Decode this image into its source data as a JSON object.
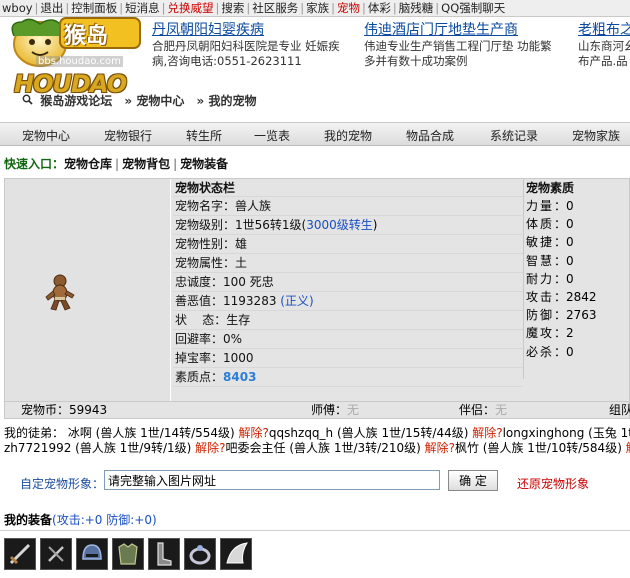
{
  "topbar": {
    "items": [
      {
        "label": "wboy",
        "hot": false
      },
      {
        "label": "退出",
        "hot": false
      },
      {
        "label": "控制面板",
        "hot": false
      },
      {
        "label": "短消息",
        "hot": false
      },
      {
        "label": "兑换威望",
        "hot": true
      },
      {
        "label": "搜索",
        "hot": false
      },
      {
        "label": "社区服务",
        "hot": false
      },
      {
        "label": "家族",
        "hot": false
      },
      {
        "label": "宠物",
        "hot": true
      },
      {
        "label": "体彩",
        "hot": false
      },
      {
        "label": "脑残糖",
        "hot": false
      },
      {
        "label": "QQ强制聊天",
        "hot": false
      }
    ]
  },
  "logo": {
    "brand": "HOUDAO",
    "chinese": "猴岛",
    "url": "bbs.houdao.com"
  },
  "ads": [
    {
      "title": "丹凤朝阳妇婴疾病",
      "lines": [
        "合肥丹凤朝阳妇科医院是专业  妊娠疾",
        "病,咨询电话:0551-2623111"
      ]
    },
    {
      "title": "伟迪酒店门厅地垫生产商",
      "lines": [
        "伟迪专业生产销售工程门厅垫  功能繁",
        "多并有数十成功案例"
      ]
    },
    {
      "title": "老粗布之",
      "lines": [
        "山东商河幺",
        "布产品.品"
      ]
    }
  ],
  "breadcrumb": {
    "items": [
      "猴岛游戏论坛",
      "» 宠物中心",
      "» 我的宠物"
    ]
  },
  "nav": {
    "items": [
      "宠物中心",
      "宠物银行",
      "转生所",
      "一览表",
      "我的宠物",
      "物品合成",
      "系统记录",
      "宠物家族"
    ]
  },
  "quick": {
    "label": "快速入口：",
    "links": [
      "宠物仓库",
      "宠物背包",
      "宠物装备"
    ]
  },
  "pet": {
    "status_title": "宠物状态栏",
    "stats_title": "宠物素质",
    "name_label": "宠物名字：",
    "name": "兽人族",
    "level_label": "宠物级别：",
    "level": "1世56转1级(",
    "level_link": "3000级转生",
    "level_end": ")",
    "gender_label": "宠物性别：",
    "gender": "雄",
    "attr_label": "宠物属性：",
    "attr": "土",
    "loyalty_label": "忠诚度：",
    "loyalty": "100 死忠",
    "karma_label": "善恶值：",
    "karma": "1193283",
    "karma_tag": "(正义)",
    "state_label": "状    态：",
    "state": "生存",
    "dodge_label": "回避率：",
    "dodge": "0%",
    "drop_label": "掉宝率：",
    "drop": "1000",
    "points_label": "素质点：",
    "points": "8403",
    "stats": [
      {
        "label": "力量：",
        "value": "0"
      },
      {
        "label": "体质：",
        "value": "0"
      },
      {
        "label": "敏捷：",
        "value": "0"
      },
      {
        "label": "智慧：",
        "value": "0"
      },
      {
        "label": "耐力：",
        "value": "0"
      },
      {
        "label": "攻击：",
        "value": "2842"
      },
      {
        "label": "防御：",
        "value": "2763"
      },
      {
        "label": "魔攻：",
        "value": "2"
      },
      {
        "label": "必杀：",
        "value": "0"
      }
    ],
    "coin_label": "宠物币：",
    "coin": "59943",
    "master_label": "师傅：",
    "master": "无",
    "partner_label": "伴侣：",
    "partner": "无",
    "team_label": "组队"
  },
  "disciples": {
    "label": "我的徒弟：",
    "line1": [
      {
        "t": "冰啊 (兽人族  1世/14转/554级)",
        "red": false
      },
      {
        "t": " 解除?",
        "red": true
      },
      {
        "t": "qqshzqq_h (兽人族  1世/15转/44级)",
        "red": false
      },
      {
        "t": " 解除?",
        "red": true
      },
      {
        "t": "longxinghong (玉兔  1t",
        "red": false
      }
    ],
    "line2": [
      {
        "t": "zh7721992 (兽人族  1世/9转/1级)",
        "red": false
      },
      {
        "t": " 解除?",
        "red": true
      },
      {
        "t": "吧委会主任 (兽人族  1世/3转/210级)",
        "red": false
      },
      {
        "t": " 解除?",
        "red": true
      },
      {
        "t": "枫竹 (兽人族  1世/10转/584级)",
        "red": false
      },
      {
        "t": " 解除",
        "red": true
      }
    ]
  },
  "custom": {
    "label": "自定宠物形象：",
    "value": "请完整输入图片网址",
    "button": "确 定",
    "restore": "还原宠物形象"
  },
  "equipment": {
    "title": "我的装备",
    "stats": "(攻击:+0 防御:+0)",
    "items": [
      "sword-icon",
      "dagger-icon",
      "helmet-icon",
      "armor-icon",
      "boots-icon",
      "ring-icon",
      "wing-icon"
    ]
  },
  "colors": {
    "link_blue": "#0b4aa0",
    "hot_red": "#cc0000",
    "panel_gray": "#e4e4e4",
    "points_blue": "#2a7ed8",
    "quick_green": "#116611"
  }
}
